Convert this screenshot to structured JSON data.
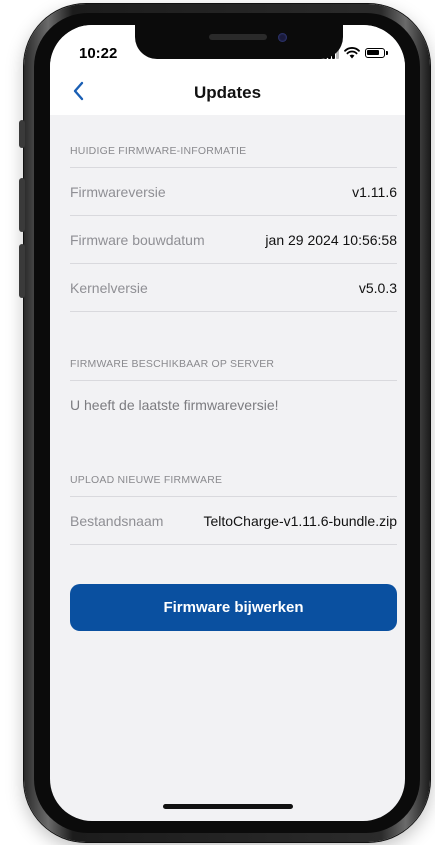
{
  "status_bar": {
    "time": "10:22",
    "icons": [
      "signal-icon",
      "wifi-icon",
      "battery-icon"
    ]
  },
  "nav": {
    "title": "Updates",
    "back_icon": "chevron-left-icon"
  },
  "sections": {
    "current_firmware": {
      "header": "HUIDIGE FIRMWARE-INFORMATIE",
      "rows": [
        {
          "label": "Firmwareversie",
          "value": "v1.11.6"
        },
        {
          "label": "Firmware bouwdatum",
          "value": "jan 29 2024 10:56:58"
        },
        {
          "label": "Kernelversie",
          "value": "v5.0.3"
        }
      ]
    },
    "server_firmware": {
      "header": "FIRMWARE BESCHIKBAAR OP SERVER",
      "message": "U heeft de laatste firmwareversie!"
    },
    "upload_firmware": {
      "header": "UPLOAD NIEUWE FIRMWARE",
      "rows": [
        {
          "label": "Bestandsnaam",
          "value": "TeltoCharge-v1.11.6-bundle.zip"
        }
      ]
    }
  },
  "actions": {
    "update_button_label": "Firmware bijwerken"
  },
  "colors": {
    "accent": "#0a50a0",
    "back_icon": "#1a5fb4",
    "background": "#f2f2f4"
  }
}
